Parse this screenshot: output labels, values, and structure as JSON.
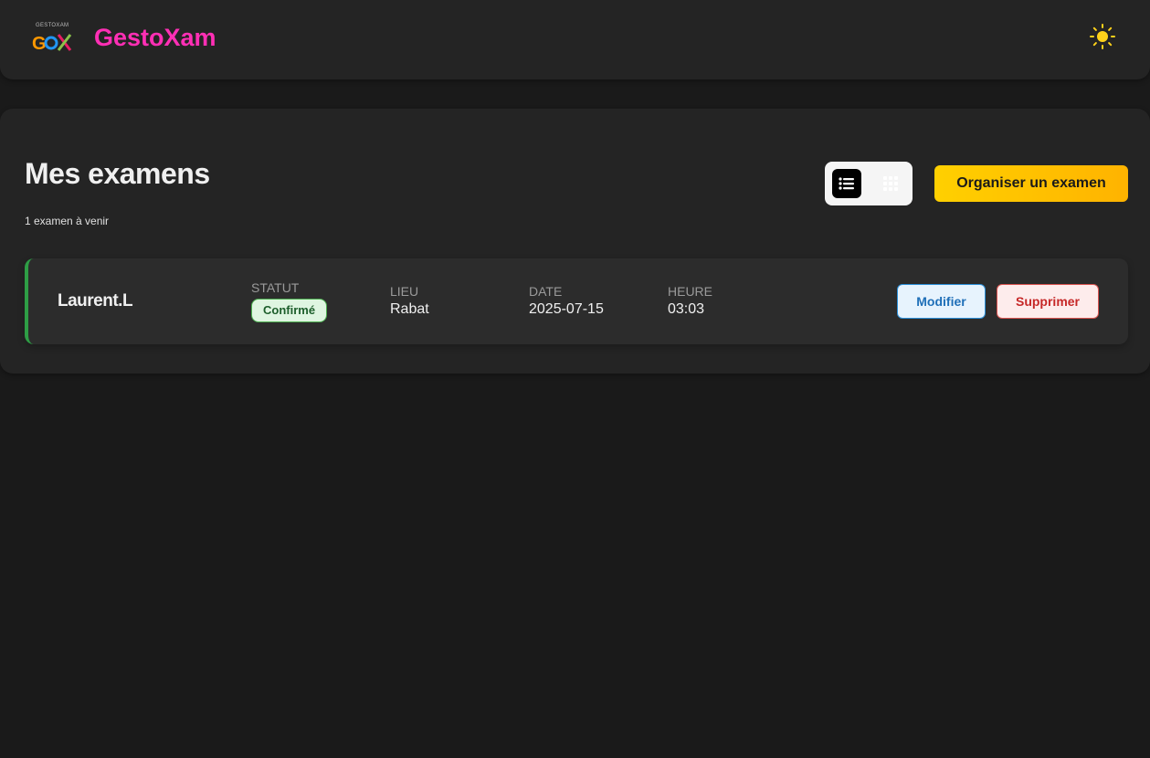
{
  "header": {
    "logo_text": "GESTOXAM",
    "logo_mark": "GOX",
    "brand": "GestoXam",
    "theme_icon": "sun-icon"
  },
  "main": {
    "title": "Mes examens",
    "subtitle": "1 examen à venir",
    "view_toggle": {
      "list_icon": "list-view-icon",
      "grid_icon": "grid-view-icon",
      "active": "list"
    },
    "primary_button": "Organiser un examen"
  },
  "exams": [
    {
      "name": "Laurent.L",
      "status_label": "STATUT",
      "status": "Confirmé",
      "location_label": "LIEU",
      "location": "Rabat",
      "date_label": "DATE",
      "date": "2025-07-15",
      "time_label": "HEURE",
      "time": "03:03",
      "edit_label": "Modifier",
      "delete_label": "Supprimer"
    }
  ],
  "colors": {
    "brand": "#ff2fb5",
    "accent": "#ffc400",
    "status_confirmed": "#4caf50",
    "edit": "#2b8fd9",
    "delete": "#d9534f"
  }
}
